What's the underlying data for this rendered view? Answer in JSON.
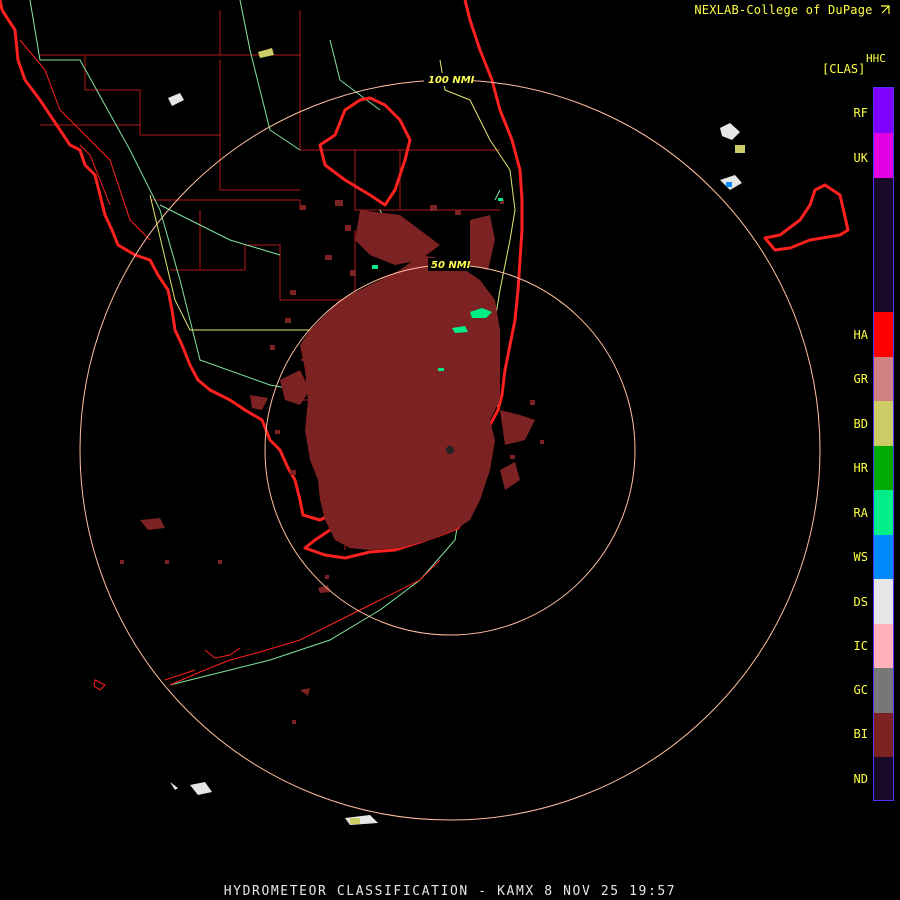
{
  "header": {
    "credit": "NEXLAB-College of DuPage",
    "credit_icon": "cursor-arrow-icon"
  },
  "product": {
    "code": "HHC",
    "name": "[CLAS]"
  },
  "rings": [
    {
      "label": "100 NMI"
    },
    {
      "label": "50 NMI"
    }
  ],
  "legend": {
    "items": [
      {
        "code": "RF",
        "color": "#7f00ff"
      },
      {
        "code": "UK",
        "color": "#e100e1"
      },
      {
        "code": "HA",
        "color": "#ff0000"
      },
      {
        "code": "GR",
        "color": "#d08080"
      },
      {
        "code": "BD",
        "color": "#cccc66"
      },
      {
        "code": "HR",
        "color": "#00aa00"
      },
      {
        "code": "RA",
        "color": "#00ee88"
      },
      {
        "code": "WS",
        "color": "#0088ff"
      },
      {
        "code": "DS",
        "color": "#e6e6e6"
      },
      {
        "code": "IC",
        "color": "#ffb0b8"
      },
      {
        "code": "GC",
        "color": "#777777"
      },
      {
        "code": "BI",
        "color": "#7c2222"
      },
      {
        "code": "ND",
        "color": "#1a0a2a"
      }
    ]
  },
  "colors": {
    "coastline": "#ff2020",
    "county_lines": "#b01818",
    "highways": "#7fe6a0",
    "interstates": "#e6e66e",
    "range_rings": "#ffc0a0",
    "background": "#000000"
  },
  "footer": {
    "caption": "HYDROMETEOR CLASSIFICATION - KAMX 8 NOV 25 19:57"
  }
}
